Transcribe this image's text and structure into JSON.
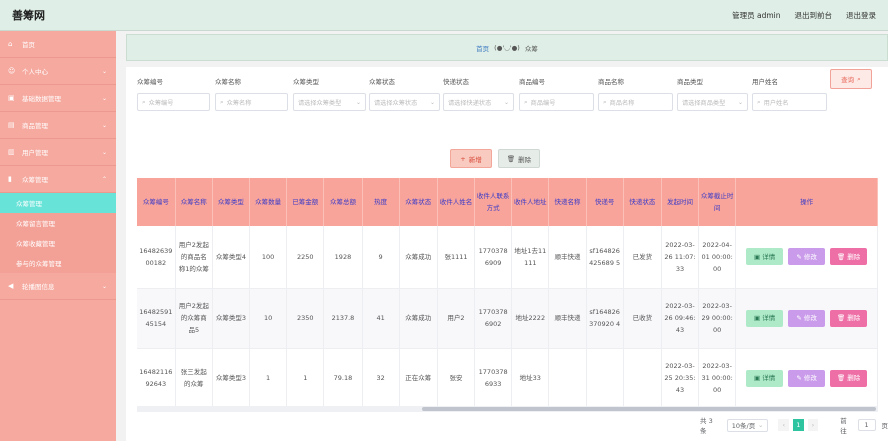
{
  "app": {
    "title": "善筹网"
  },
  "header": {
    "user": "管理员 admin",
    "front": "退出到前台",
    "logout": "退出登录"
  },
  "sidebar": {
    "items": [
      {
        "label": "首页",
        "icon": "home-icon"
      },
      {
        "label": "个人中心",
        "icon": "user-icon"
      },
      {
        "label": "基础数据管理",
        "icon": "data-icon"
      },
      {
        "label": "商品管理",
        "icon": "goods-icon"
      },
      {
        "label": "用户管理",
        "icon": "users-icon"
      },
      {
        "label": "众筹管理",
        "icon": "chart-icon"
      }
    ],
    "sub_items": [
      {
        "label": "众筹管理",
        "active": true
      },
      {
        "label": "众筹留言管理"
      },
      {
        "label": "众筹收藏管理"
      },
      {
        "label": "参与的众筹管理"
      }
    ],
    "last": {
      "label": "轮播图信息",
      "icon": "carousel-icon"
    }
  },
  "breadcrumb": {
    "home": "首页",
    "sep": "(●'◡'●)",
    "current": "众筹"
  },
  "filters": [
    {
      "label": "众筹编号",
      "placeholder": "众筹编号",
      "type": "input"
    },
    {
      "label": "众筹名称",
      "placeholder": "众筹名称",
      "type": "input"
    },
    {
      "label": "众筹类型",
      "placeholder": "请选择众筹类型",
      "type": "select"
    },
    {
      "label": "众筹状态",
      "placeholder": "请选择众筹状态",
      "type": "select"
    },
    {
      "label": "快递状态",
      "placeholder": "请选择快递状态",
      "type": "select"
    },
    {
      "label": "商品编号",
      "placeholder": "商品编号",
      "type": "input"
    },
    {
      "label": "商品名称",
      "placeholder": "商品名称",
      "type": "input"
    },
    {
      "label": "商品类型",
      "placeholder": "请选择商品类型",
      "type": "select"
    },
    {
      "label": "用户姓名",
      "placeholder": "用户姓名",
      "type": "input"
    }
  ],
  "actions": {
    "search": "查询",
    "add": "新增",
    "delete": "删除"
  },
  "table": {
    "columns": [
      "众筹编号",
      "众筹名称",
      "众筹类型",
      "众筹数量",
      "已筹金额",
      "众筹总额",
      "热度",
      "众筹状态",
      "收件人姓名",
      "收件人联系方式",
      "收件人地址",
      "快递名称",
      "快递号",
      "快递状态",
      "发起时间",
      "众筹截止时间",
      "操作"
    ],
    "rows": [
      [
        "1648263900182",
        "用户2发起的商品名称1的众筹",
        "众筹类型4",
        "100",
        "2250",
        "1928",
        "9",
        "众筹成功",
        "张1111",
        "17703786909",
        "地址1去11111",
        "顺丰快递",
        "sf164826425689 5",
        "已发货",
        "2022-03-26 11:07:33",
        "2022-04-01 00:00:00"
      ],
      [
        "1648259145154",
        "用户2发起的众筹商品5",
        "众筹类型3",
        "10",
        "2350",
        "2137.8",
        "41",
        "众筹成功",
        "用户2",
        "17703786902",
        "地址2222",
        "顺丰快递",
        "sf164826370920 4",
        "已收货",
        "2022-03-26 09:46:43",
        "2022-03-29 00:00:00"
      ],
      [
        "1648211692643",
        "张三发起的众筹",
        "众筹类型3",
        "1",
        "1",
        "79.18",
        "32",
        "正在众筹",
        "张安",
        "17703786933",
        "地址33",
        "",
        "",
        "",
        "2022-03-25 20:35:43",
        "2022-03-31 00:00:00"
      ]
    ],
    "op_labels": {
      "detail": "详情",
      "edit": "修改",
      "remove": "删除"
    }
  },
  "pager": {
    "total": "共 3 条",
    "size": "10条/页",
    "page": "1",
    "goto": "前往",
    "goto_value": "1",
    "unit": "页"
  },
  "colors": {
    "sidebar": "#f5a99f",
    "header": "#dfeee6",
    "active": "#67e3d8",
    "th": "#f8a49a"
  }
}
